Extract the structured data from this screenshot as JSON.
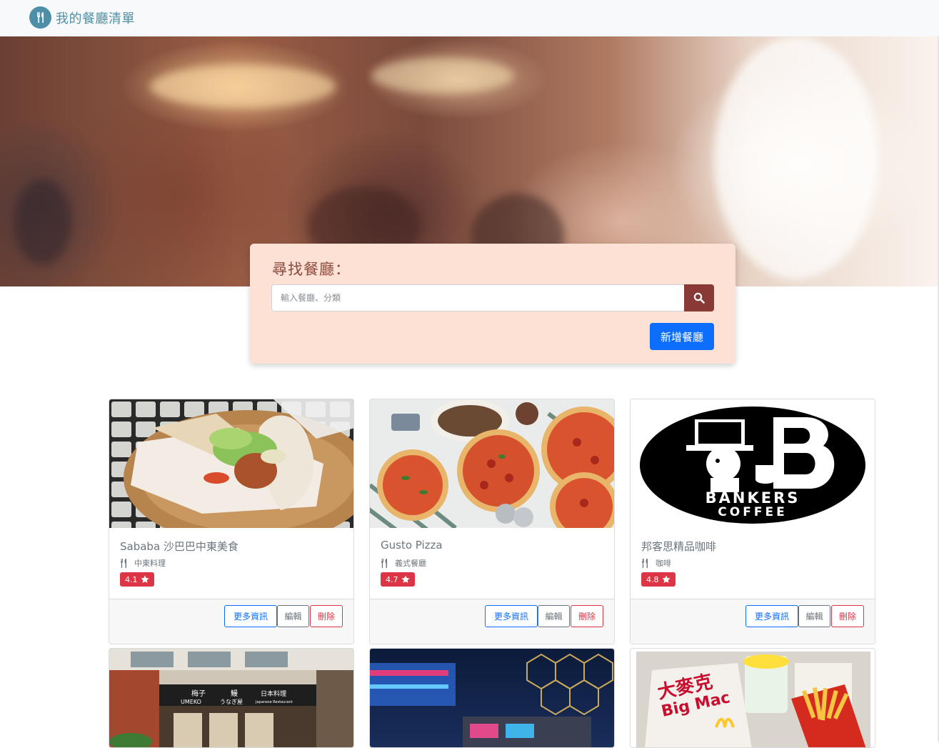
{
  "navbar": {
    "brand": "我的餐廳清單",
    "logo_icon": "utensils-icon"
  },
  "search": {
    "title": "尋找餐廳：",
    "placeholder": "輸入餐廳、分類",
    "value": "",
    "search_icon": "search-icon",
    "add_label": "新增餐廳"
  },
  "restaurants": [
    {
      "name": "Sababa 沙巴巴中東美食",
      "category": "中東料理",
      "rating": "4.1",
      "more": "更多資訊",
      "edit": "編輯",
      "delete": "刪除"
    },
    {
      "name": "Gusto Pizza",
      "category": "義式餐廳",
      "rating": "4.7",
      "more": "更多資訊",
      "edit": "編輯",
      "delete": "刪除"
    },
    {
      "name": "邦客思精品咖啡",
      "category": "咖啡",
      "rating": "4.8",
      "more": "更多資訊",
      "edit": "編輯",
      "delete": "刪除"
    },
    {
      "name": "",
      "category": "",
      "rating": ""
    },
    {
      "name": "",
      "category": "",
      "rating": ""
    },
    {
      "name": "",
      "category": "",
      "rating": ""
    }
  ],
  "bankers_logo": {
    "line1": "BANKERS",
    "line2": "COFFEE"
  },
  "umeko_sign": {
    "name_zh": "梅子",
    "name_en": "UMEKO",
    "eel": "鰻",
    "eel_kana": "うなぎ屋",
    "cuisine": "日本料理",
    "cuisine_en": "Japanese Restaurant"
  },
  "mcd_sign": {
    "zh": "大麥克",
    "en": "Big Mac"
  },
  "colors": {
    "brand": "#4d8fa6",
    "panel": "#fde1d4",
    "primary": "#0d6efd",
    "danger": "#dc3545",
    "search_btn": "#8a3a36"
  }
}
